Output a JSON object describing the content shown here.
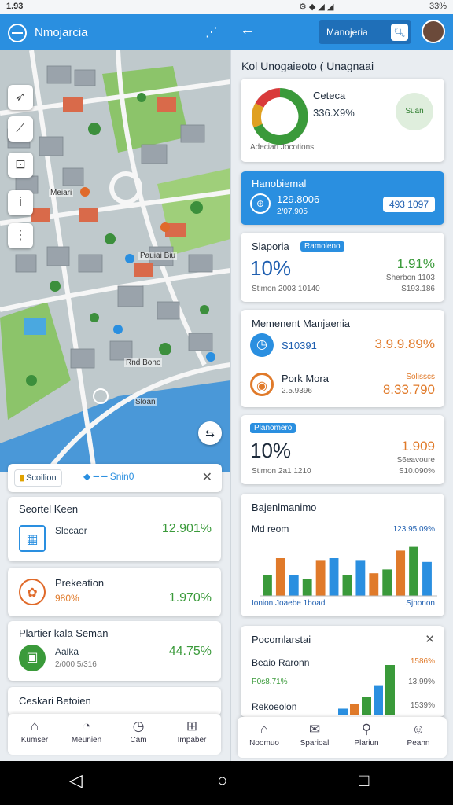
{
  "status": {
    "time": "1.93",
    "battery": "33%"
  },
  "left": {
    "header": {
      "title": "Nmojarcia"
    },
    "map_labels": [
      "Meiari",
      "Pauiai Biu",
      "Rnd Bono",
      "Sloan"
    ],
    "filter": {
      "chip": "Scoilion",
      "middle": "Snin0"
    },
    "cards": [
      {
        "title": "Seortel Keen",
        "line": "Slecaor",
        "value": "12.901%"
      },
      {
        "title": "Prekeation",
        "line": "980%",
        "value": "1.970%"
      },
      {
        "title": "Plartier kala Seman",
        "line": "Aalka",
        "sub": "2/000 5/316",
        "value": "44.75%"
      },
      {
        "title": "Ceskari Betoien"
      }
    ],
    "nav": [
      "Kumser",
      "Meunien",
      "Cam",
      "Impaber"
    ]
  },
  "right": {
    "header": {
      "search": "Manojeria"
    },
    "title": "Kol Unogaieoto ( Unagnaai",
    "summary": {
      "label": "Ceteca",
      "value": "336.X9%",
      "caption": "Adeciari Jocotions",
      "badge": "Suan"
    },
    "blue_card": {
      "title": "Hanobiemal",
      "value": "129.8006",
      "sub": "2/07.905",
      "button": "493 1097"
    },
    "card_a": {
      "title": "Slaporia",
      "pill": "Ramoleno",
      "big": "10%",
      "caption": "Stimon 2003 10140",
      "value": "1.91%",
      "sub1": "Sherbon 1103",
      "sub2": "S193.186"
    },
    "card_b": {
      "title": "Memenent Manjaenia",
      "row1": {
        "label": "S10391",
        "value": "3.9.9.89%"
      },
      "row2": {
        "label": "Pork Mora",
        "sub": "2.5.9396",
        "value": "8.33.790",
        "small": "Solisscs"
      }
    },
    "card_c": {
      "pill": "Planomero",
      "big": "10%",
      "caption": "Stimon 2a1 1210",
      "value": "1.909",
      "sub1": "S6eavoure",
      "sub2": "S10.090%"
    },
    "chart_card": {
      "title": "Bajenlmanimo",
      "label": "Md reom",
      "value_label": "123.95.09%",
      "footer_left": "Ionion Joaebe 1boad",
      "footer_right": "Sjnonon"
    },
    "bottom_card": {
      "title": "Pocomlarstai",
      "row1": "Beaio Raronn",
      "row1_val": "1586%",
      "row2": "P0s8.71%",
      "row2_val": "13.99%",
      "row3": "Rekoeolon",
      "row3_val": "1539%"
    },
    "nav": [
      "Noomuo",
      "Sparioal",
      "Plariun",
      "Peahn"
    ]
  },
  "chart_data": {
    "type": "bar",
    "categories": [
      "1",
      "2",
      "3",
      "4",
      "5",
      "6",
      "7",
      "8",
      "9",
      "10",
      "11",
      "12",
      "13"
    ],
    "series": [
      {
        "name": "green",
        "values": [
          22,
          40,
          22,
          18,
          38,
          40,
          22,
          38,
          24,
          28,
          48,
          52,
          36
        ]
      },
      {
        "name": "orange",
        "values": [
          0,
          0,
          0,
          0,
          0,
          0,
          0,
          0,
          0,
          0,
          56,
          0,
          0
        ]
      }
    ],
    "ylim": [
      0,
      60
    ]
  },
  "mini_chart": {
    "values": [
      8,
      14,
      22,
      36,
      60
    ]
  }
}
